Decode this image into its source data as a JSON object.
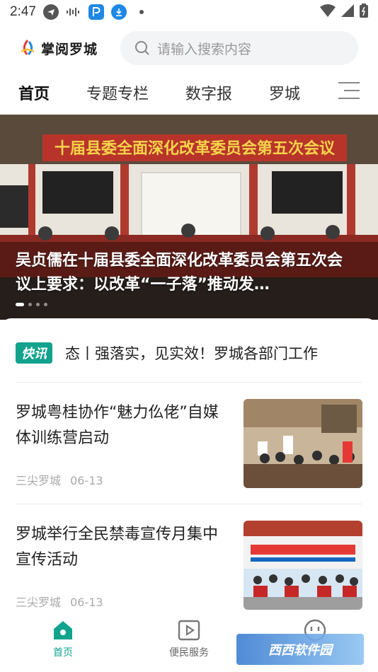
{
  "status_bar": {
    "time": "2:47"
  },
  "header": {
    "logo_text": "掌阅罗城",
    "search_placeholder": "请输入搜索内容"
  },
  "tabs": [
    {
      "label": "首页",
      "active": true
    },
    {
      "label": "专题专栏",
      "active": false
    },
    {
      "label": "数字报",
      "active": false
    },
    {
      "label": "罗城",
      "active": false
    }
  ],
  "banner": {
    "sign_text": "十届县委全面深化改革委员会第五次会议",
    "title": "吴贞儒在十届县委全面深化改革委员会第五次会议上要求：以改革“一子落”推动发…",
    "slide_count": 4,
    "active_slide": 1
  },
  "flash": {
    "badge": "快讯",
    "text": "态丨强落实，见实效！罗城各部门工作"
  },
  "news": [
    {
      "title": "罗城粤桂协作“魅力仫佬”自媒体训练营启动",
      "source": "三尖罗城",
      "date": "06-13"
    },
    {
      "title": "罗城举行全民禁毒宣传月集中宣传活动",
      "source": "三尖罗城",
      "date": "06-13"
    }
  ],
  "bottom_nav": [
    {
      "label": "首页",
      "icon": "home-icon",
      "active": true
    },
    {
      "label": "便民服务",
      "icon": "play-icon",
      "active": false
    },
    {
      "label": "",
      "icon": "smile-icon",
      "active": false
    }
  ],
  "watermark": {
    "text": "西西软件园",
    "url": "CR173.COM"
  },
  "colors": {
    "accent": "#12a38d",
    "banner_sign": "#c0392b"
  }
}
